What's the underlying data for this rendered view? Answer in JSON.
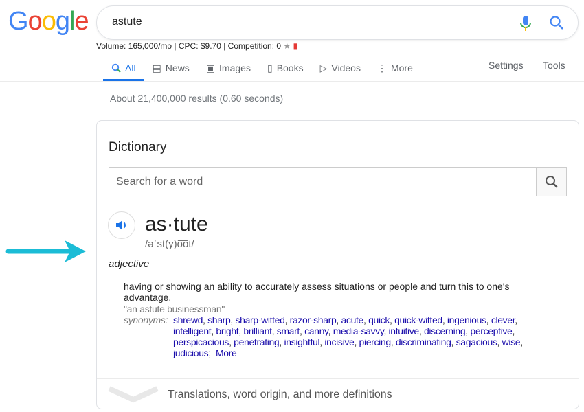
{
  "logo": "Google",
  "search": {
    "query": "astute"
  },
  "seo_bar": "Volume: 165,000/mo | CPC: $9.70 | Competition: 0",
  "tabs": [
    {
      "label": "All",
      "icon": "search-icon",
      "active": true
    },
    {
      "label": "News",
      "icon": "news-icon"
    },
    {
      "label": "Images",
      "icon": "image-icon"
    },
    {
      "label": "Books",
      "icon": "book-icon"
    },
    {
      "label": "Videos",
      "icon": "video-icon"
    },
    {
      "label": "More",
      "icon": "more-vert-icon"
    }
  ],
  "tools": {
    "settings": "Settings",
    "tools": "Tools"
  },
  "result_stats": "About 21,400,000 results (0.60 seconds)",
  "dictionary": {
    "title": "Dictionary",
    "search_placeholder": "Search for a word",
    "word": "as·tute",
    "phonetic": "/əˈst(y)o͞ot/",
    "part_of_speech": "adjective",
    "definition": "having or showing an ability to accurately assess situations or people and turn this to one's advantage.",
    "example": "\"an astute businessman\"",
    "synonyms_label": "synonyms:",
    "synonyms": [
      "shrewd",
      "sharp",
      "sharp-witted",
      "razor-sharp",
      "acute",
      "quick",
      "quick-witted",
      "ingenious",
      "clever",
      "intelligent",
      "bright",
      "brilliant",
      "smart",
      "canny",
      "media-savvy",
      "intuitive",
      "discerning",
      "perceptive",
      "perspicacious",
      "penetrating",
      "insightful",
      "incisive",
      "piercing",
      "discriminating",
      "sagacious",
      "wise",
      "judicious"
    ],
    "more_label": "More",
    "expand_label": "Translations, word origin, and more definitions"
  },
  "colors": {
    "accent": "#1a73e8",
    "link": "#1a0dab",
    "arrow": "#1bbcd6"
  }
}
